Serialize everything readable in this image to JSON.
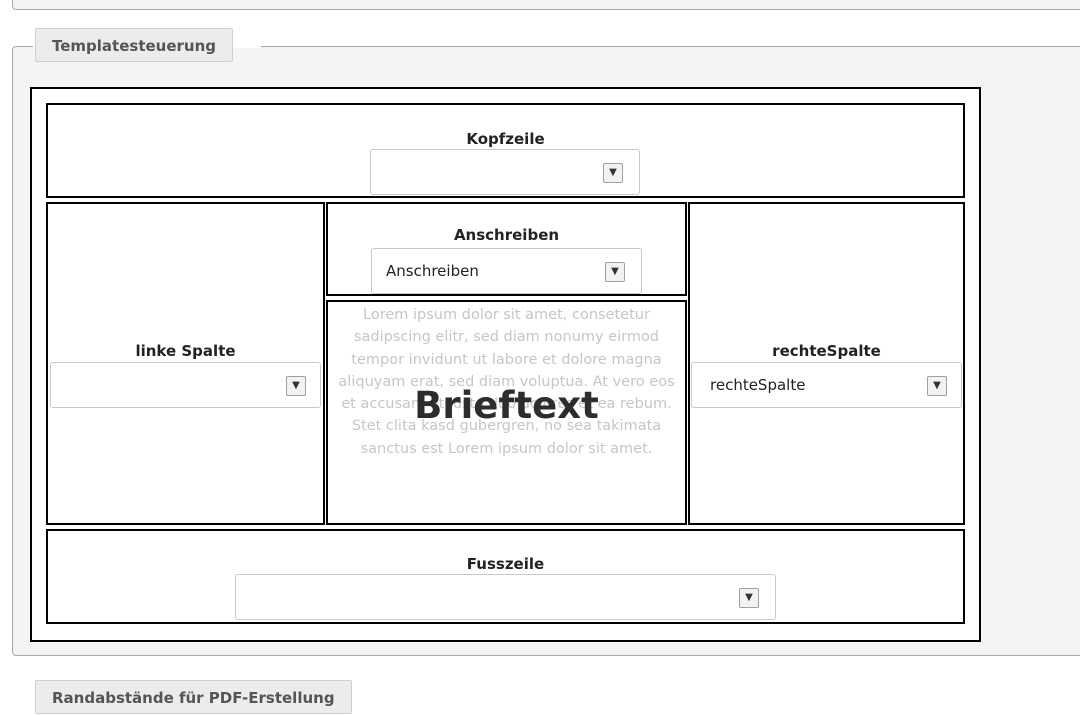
{
  "sections": {
    "template_control": "Templatesteuerung",
    "margins": "Randabstände für PDF-Erstellung"
  },
  "template": {
    "header": {
      "label": "Kopfzeile",
      "selected": ""
    },
    "anschreiben": {
      "label": "Anschreiben",
      "selected": "Anschreiben"
    },
    "left_column": {
      "label": "linke Spalte",
      "selected": ""
    },
    "right_column": {
      "label": "rechteSpalte",
      "selected": "rechteSpalte"
    },
    "footer": {
      "label": "Fusszeile",
      "selected": ""
    },
    "brief": {
      "title": "Brieftext",
      "placeholder": "Lorem ipsum dolor sit amet, consetetur sadipscing elitr, sed diam nonumy eirmod tempor invidunt ut labore et dolore magna aliquyam erat, sed diam voluptua. At vero eos et accusam et justo duo dolores et ea rebum. Stet clita kasd gubergren, no sea takimata sanctus est Lorem ipsum dolor sit amet."
    }
  },
  "icons": {
    "dropdown": "chevron-down-icon"
  }
}
